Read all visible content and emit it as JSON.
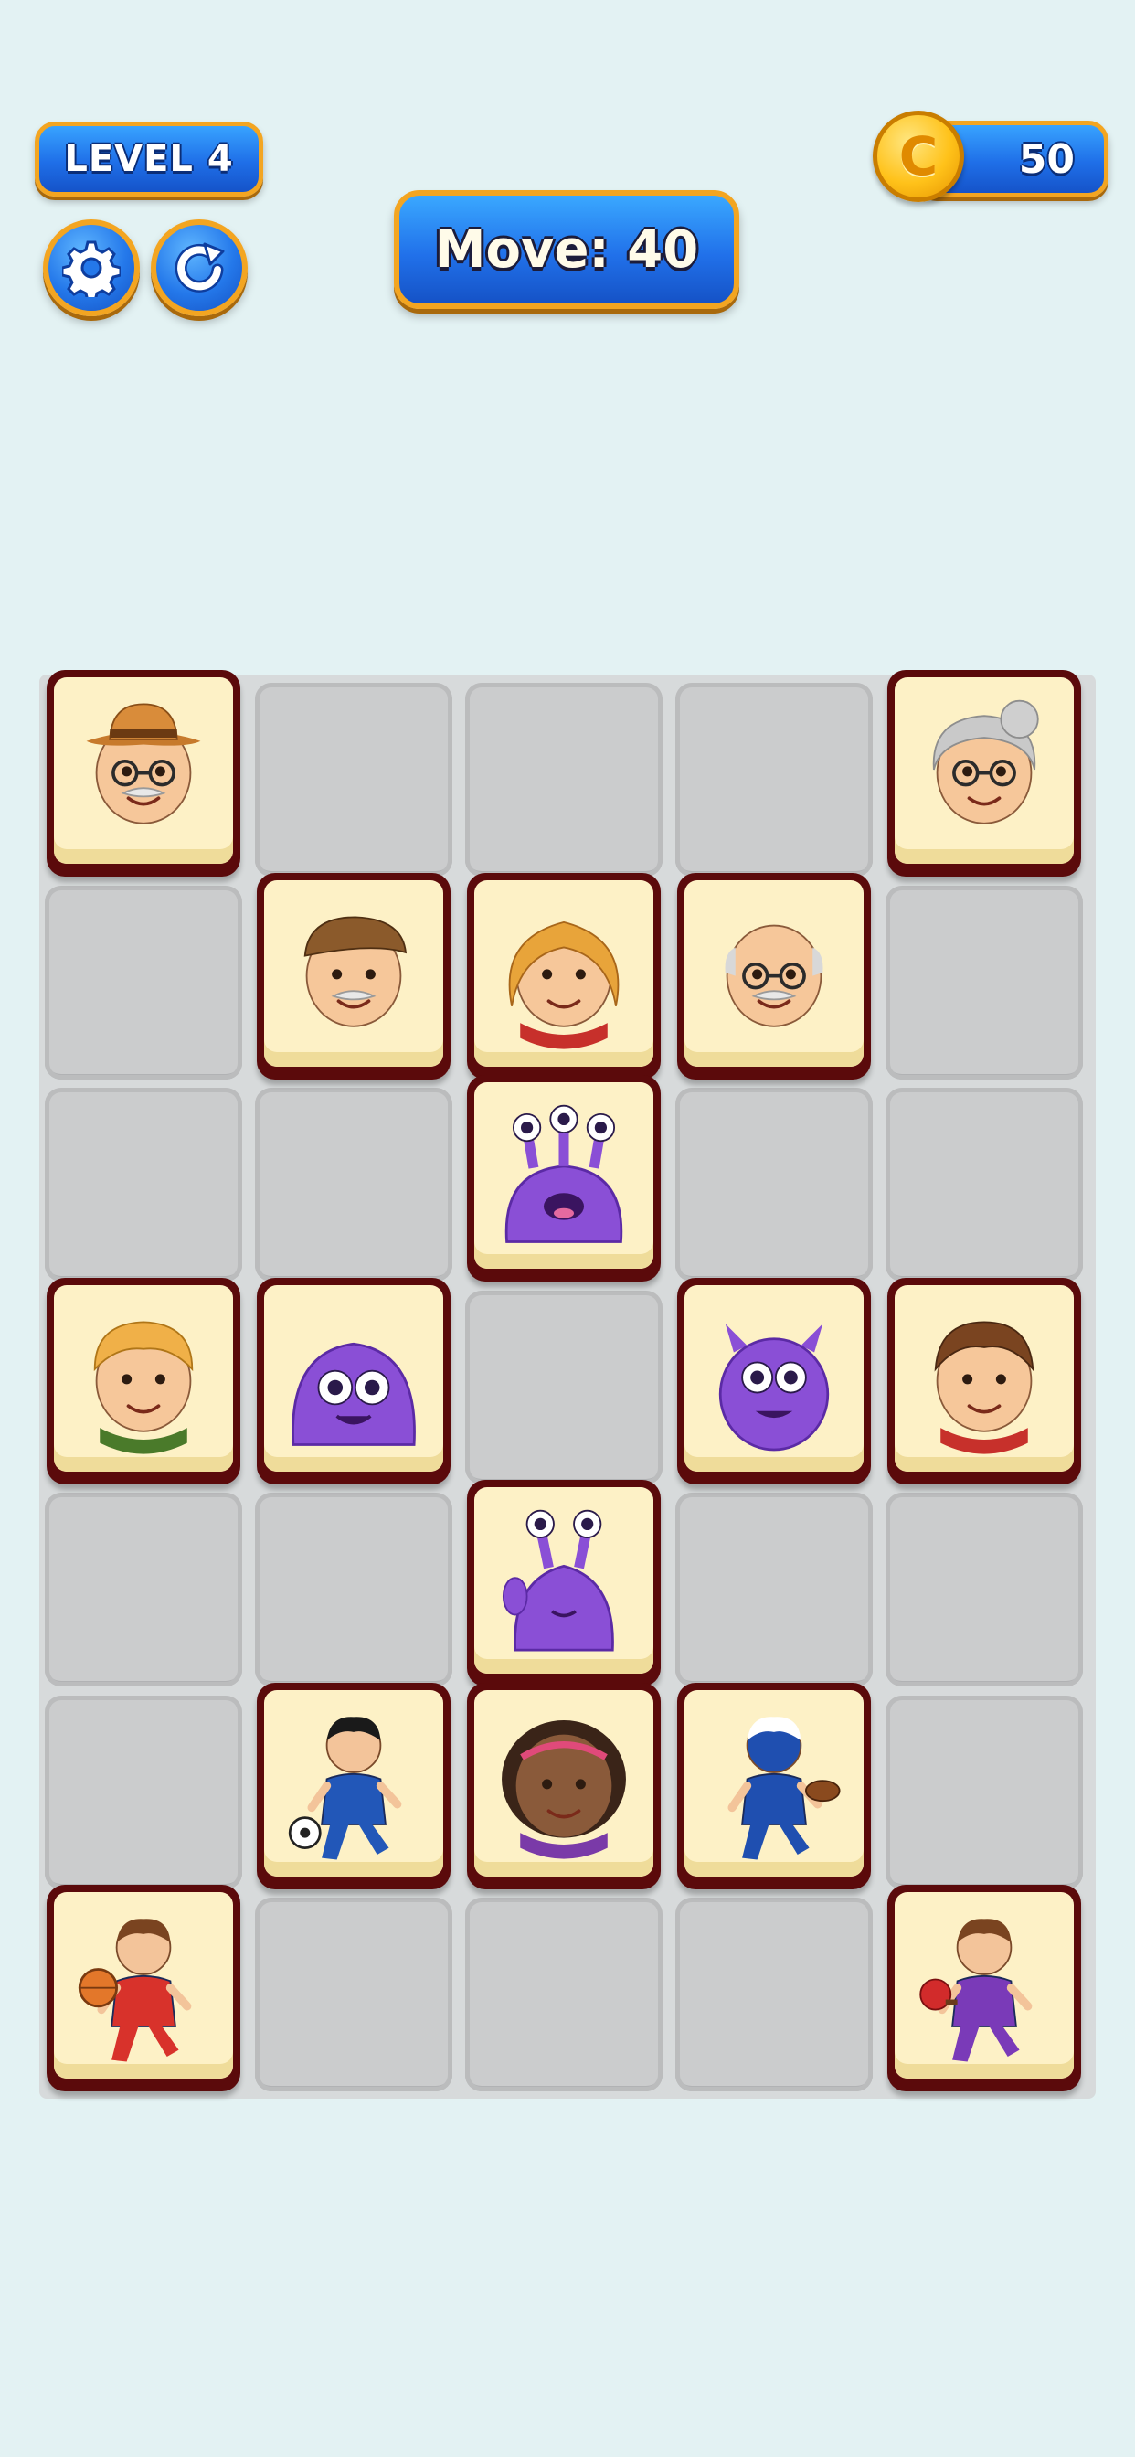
{
  "hud": {
    "level_label": "LEVEL 4",
    "moves_label": "Move: 40",
    "coins": "50",
    "coin_symbol": "C"
  },
  "board": {
    "cols": 5,
    "rows": 7,
    "tiles": [
      {
        "row": 0,
        "col": 0,
        "character": "grandpa-hat"
      },
      {
        "row": 0,
        "col": 4,
        "character": "grandma"
      },
      {
        "row": 1,
        "col": 1,
        "character": "grandpa-cap"
      },
      {
        "row": 1,
        "col": 2,
        "character": "girl-red-scarf"
      },
      {
        "row": 1,
        "col": 3,
        "character": "grandpa-bald"
      },
      {
        "row": 2,
        "col": 2,
        "character": "three-eyed-monster"
      },
      {
        "row": 3,
        "col": 0,
        "character": "boy-green-scarf"
      },
      {
        "row": 3,
        "col": 1,
        "character": "purple-blob-monster"
      },
      {
        "row": 3,
        "col": 3,
        "character": "horned-monster"
      },
      {
        "row": 3,
        "col": 4,
        "character": "boy-red-scarf"
      },
      {
        "row": 4,
        "col": 2,
        "character": "waving-slug-monster"
      },
      {
        "row": 5,
        "col": 1,
        "character": "soccer-player"
      },
      {
        "row": 5,
        "col": 2,
        "character": "girl-purple-scarf"
      },
      {
        "row": 5,
        "col": 3,
        "character": "football-player"
      },
      {
        "row": 6,
        "col": 0,
        "character": "basketball-player"
      },
      {
        "row": 6,
        "col": 4,
        "character": "ping-pong-player"
      }
    ]
  },
  "colors": {
    "background": "#e3f2f3",
    "hud_blue": "#1f6fe8",
    "hud_border": "#f3a521",
    "tile_border": "#5b0a0b",
    "tile_face": "#fdf1c6",
    "cell": "#cbcccd"
  }
}
